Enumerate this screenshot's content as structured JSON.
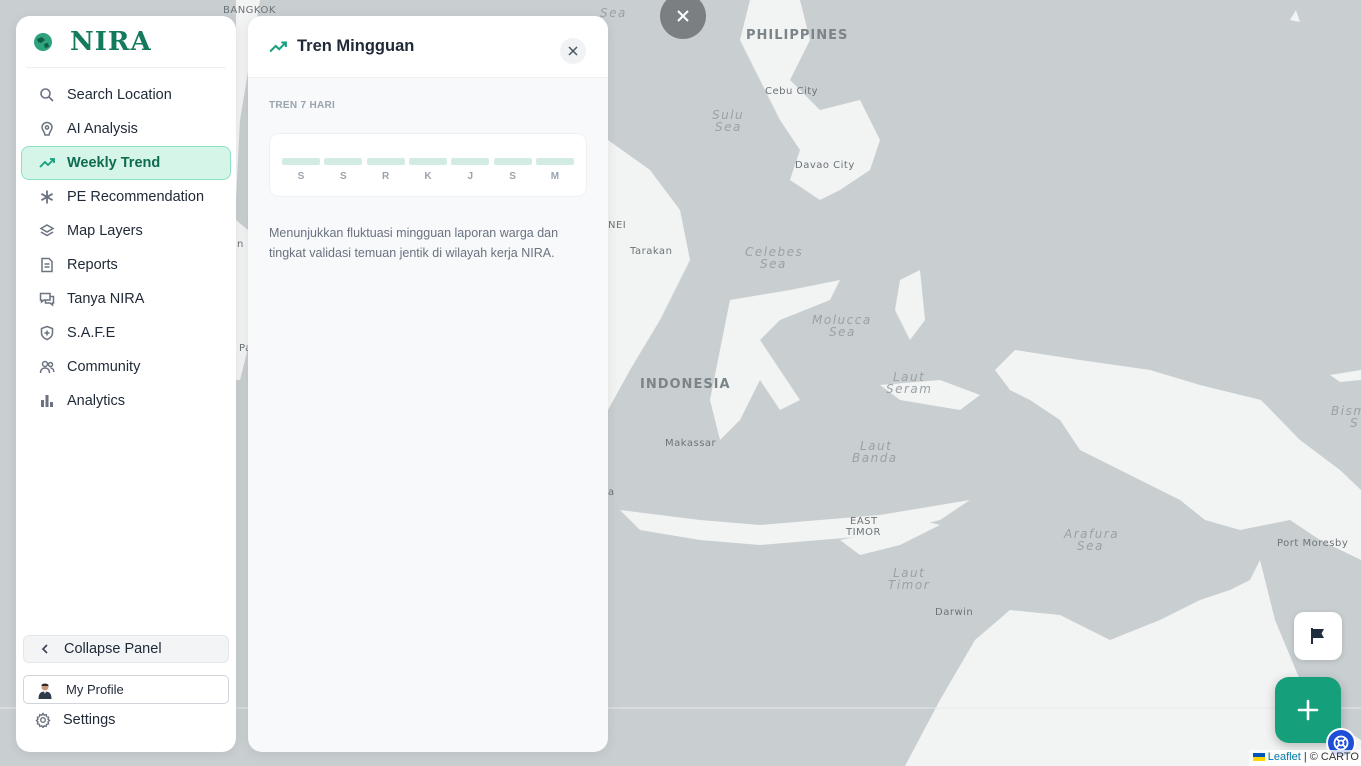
{
  "app": {
    "logo_text": "NIRA"
  },
  "sidebar": {
    "items": [
      {
        "label": "Search Location",
        "icon": "search-icon"
      },
      {
        "label": "AI Analysis",
        "icon": "ai-analysis-icon"
      },
      {
        "label": "Weekly Trend",
        "icon": "trend-icon",
        "active": true
      },
      {
        "label": "PE Recommendation",
        "icon": "asterisk-icon"
      },
      {
        "label": "Map Layers",
        "icon": "layers-icon"
      },
      {
        "label": "Reports",
        "icon": "document-icon"
      },
      {
        "label": "Tanya NIRA",
        "icon": "chat-icon"
      },
      {
        "label": "S.A.F.E",
        "icon": "shield-icon"
      },
      {
        "label": "Community",
        "icon": "users-icon"
      },
      {
        "label": "Analytics",
        "icon": "bar-chart-icon"
      }
    ],
    "collapse_label": "Collapse Panel",
    "profile_label": "My Profile",
    "settings_label": "Settings"
  },
  "panel": {
    "title": "Tren Mingguan",
    "section_label": "TREN 7 HARI",
    "days": [
      "S",
      "S",
      "R",
      "K",
      "J",
      "S",
      "M"
    ],
    "description": "Menunjukkan fluktuasi mingguan laporan warga dan tingkat validasi temuan jentik di wilayah kerja NIRA."
  },
  "map": {
    "labels": {
      "bangkok": "BANGKOK",
      "china_sea": "Sea",
      "philippines": "PHILIPPINES",
      "cebu": "Cebu City",
      "sulu_1": "Sulu",
      "sulu_2": "Sea",
      "davao": "Davao City",
      "brunei": "NEI",
      "tarakan": "Tarakan",
      "celebes_1": "Celebes",
      "celebes_2": "Sea",
      "molucca_1": "Molucca",
      "molucca_2": "Sea",
      "indonesia": "INDONESIA",
      "seram_1": "Laut",
      "seram_2": "Seram",
      "bismarck_1": "Bism",
      "bismarck_2": "S",
      "makassar": "Makassar",
      "banda_1": "Laut",
      "banda_2": "Banda",
      "east_timor_1": "EAST",
      "east_timor_2": "TIMOR",
      "arafura_1": "Arafura",
      "arafura_2": "Sea",
      "port_moresby": "Port Moresby",
      "timor_1": "Laut",
      "timor_2": "Timor",
      "darwin": "Darwin",
      "left_n": "n",
      "left_pa": "Pa",
      "left_a": "a"
    },
    "attribution_leaflet": "Leaflet",
    "attribution_rest": "| © CARTO"
  }
}
